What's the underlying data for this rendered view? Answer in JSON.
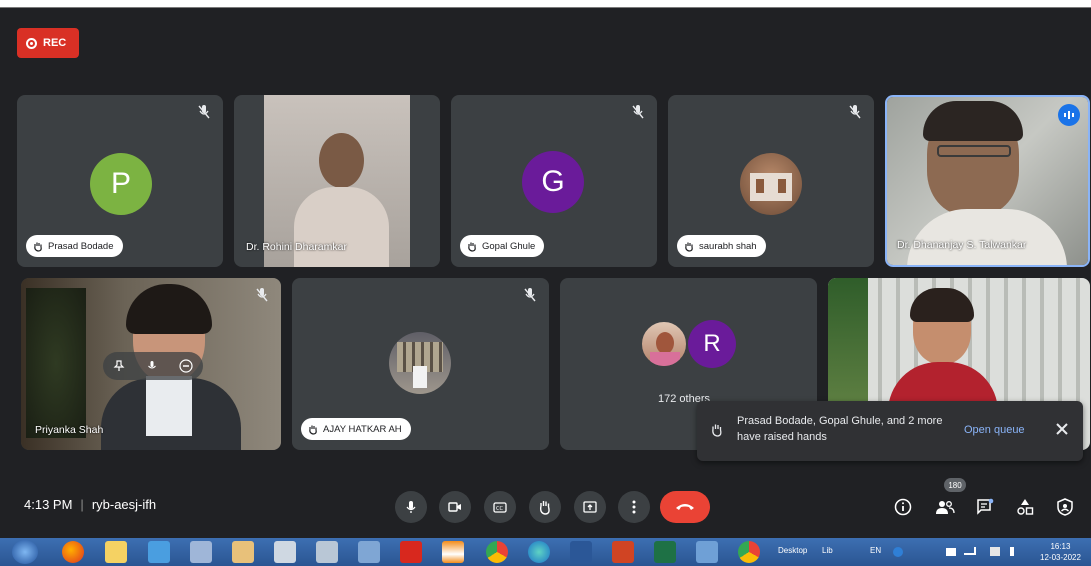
{
  "meeting": {
    "rec_label": "REC",
    "time": "4:13 PM",
    "code": "ryb-aesj-ifh",
    "participant_count": "180"
  },
  "tiles": {
    "prasad": {
      "initial": "P",
      "name": "Prasad Bodade",
      "color": "#7cb342"
    },
    "rohini": {
      "name": "Dr. Rohini Dharamkar"
    },
    "gopal": {
      "initial": "G",
      "name": "Gopal Ghule",
      "color": "#6a1b9a"
    },
    "saurabh": {
      "name": "saurabh shah"
    },
    "dhananjay": {
      "name": "Dr. Dhananjay S. Talwankar"
    },
    "priyanka": {
      "name": "Priyanka Shah"
    },
    "ajay": {
      "name": "AJAY HATKAR AH"
    },
    "others": {
      "initial": "R",
      "label": "172 others",
      "color": "#6a1b9a"
    }
  },
  "toast": {
    "message": "Prasad Bodade, Gopal Ghule, and 2 more have raised hands",
    "action": "Open queue"
  },
  "taskbar": {
    "desktop_label": "Desktop",
    "lib_label": "Lib",
    "lang": "EN",
    "clock_time": "16:13",
    "clock_date": "12-03-2022"
  },
  "icons": {
    "rec": "record-icon",
    "mic": "mic-icon",
    "camera": "camera-icon",
    "captions": "captions-icon",
    "raise_hand": "raise-hand-icon",
    "present": "present-icon",
    "more": "more-options-icon",
    "end_call": "end-call-icon",
    "info": "info-icon",
    "people": "people-icon",
    "chat": "chat-icon",
    "activities": "activities-icon",
    "host": "host-controls-icon"
  }
}
